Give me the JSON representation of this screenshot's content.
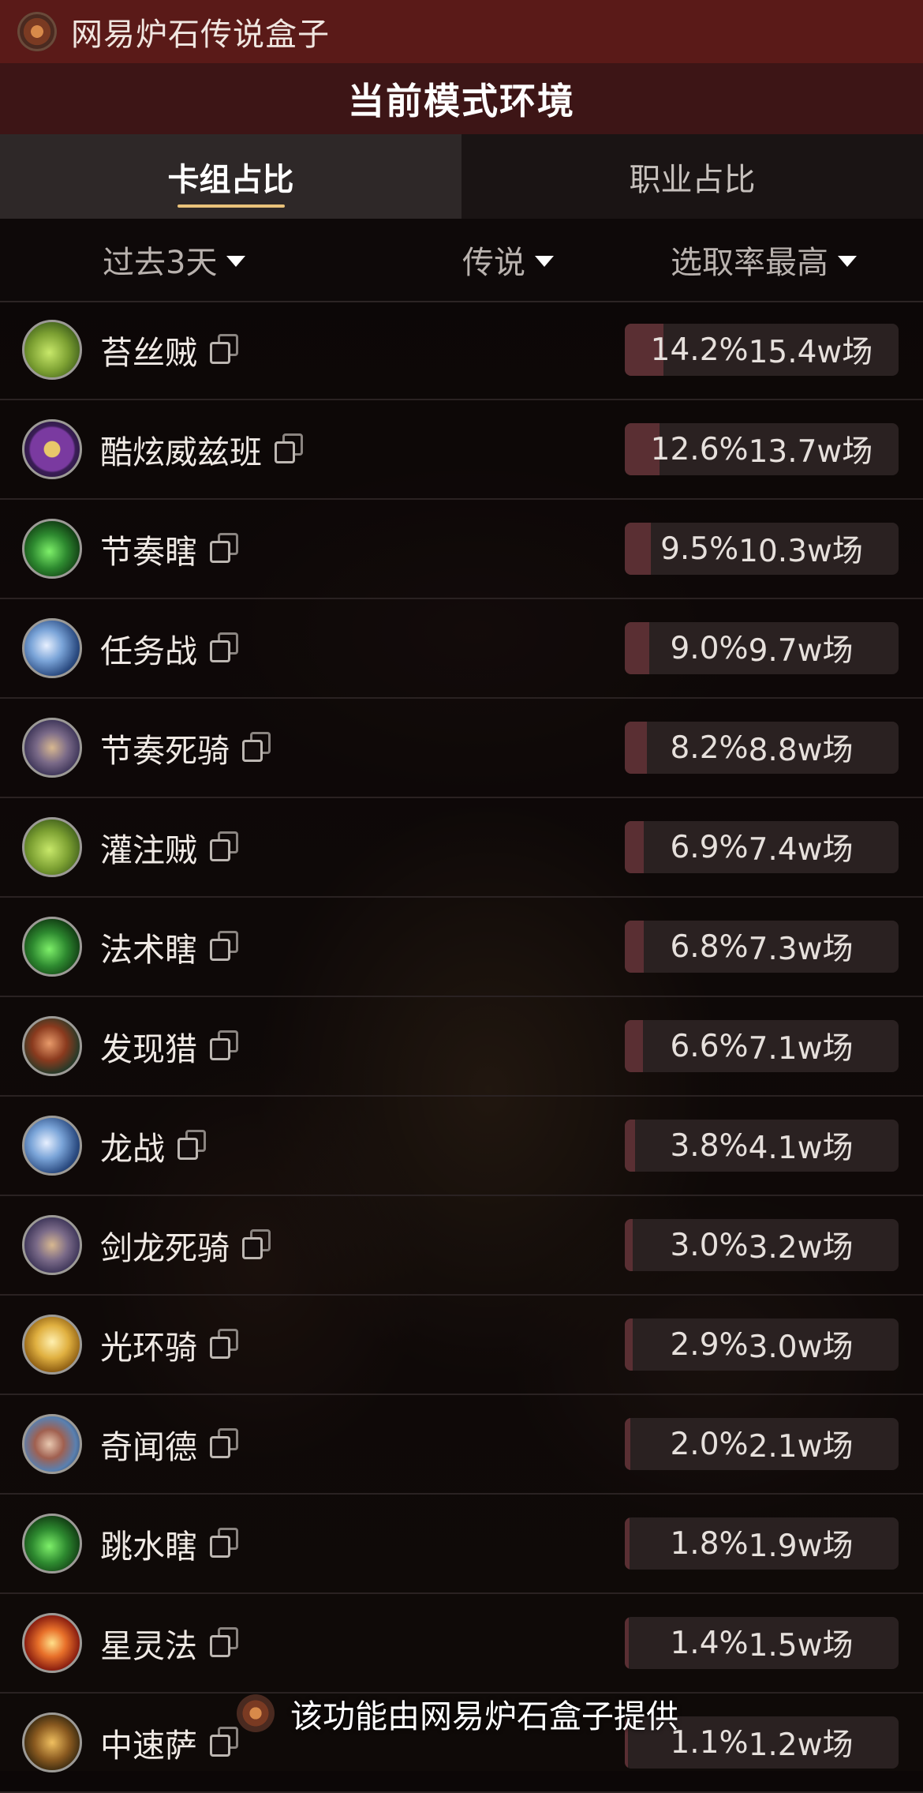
{
  "app": {
    "title": "网易炉石传说盒子"
  },
  "mode": {
    "title": "当前模式环境"
  },
  "tabs": [
    {
      "label": "卡组占比",
      "active": true
    },
    {
      "label": "职业占比",
      "active": false
    }
  ],
  "filters": {
    "time": "过去3天",
    "rank": "传说",
    "sort": "选取率最高"
  },
  "decks": [
    {
      "name": "苔丝贼",
      "rate": "14.2%",
      "games": "15.4w场",
      "rate_value": 14.2,
      "icon": "rogue-class-icon"
    },
    {
      "name": "酷炫威兹班",
      "rate": "12.6%",
      "games": "13.7w场",
      "rate_value": 12.6,
      "icon": "mystery-question-icon"
    },
    {
      "name": "节奏瞎",
      "rate": "9.5%",
      "games": "10.3w场",
      "rate_value": 9.5,
      "icon": "demon-hunter-class-icon"
    },
    {
      "name": "任务战",
      "rate": "9.0%",
      "games": "9.7w场",
      "rate_value": 9.0,
      "icon": "warrior-class-icon"
    },
    {
      "name": "节奏死骑",
      "rate": "8.2%",
      "games": "8.8w场",
      "rate_value": 8.2,
      "icon": "death-knight-class-icon"
    },
    {
      "name": "灌注贼",
      "rate": "6.9%",
      "games": "7.4w场",
      "rate_value": 6.9,
      "icon": "rogue-class-icon"
    },
    {
      "name": "法术瞎",
      "rate": "6.8%",
      "games": "7.3w场",
      "rate_value": 6.8,
      "icon": "demon-hunter-class-icon"
    },
    {
      "name": "发现猎",
      "rate": "6.6%",
      "games": "7.1w场",
      "rate_value": 6.6,
      "icon": "hunter-class-icon"
    },
    {
      "name": "龙战",
      "rate": "3.8%",
      "games": "4.1w场",
      "rate_value": 3.8,
      "icon": "warrior-class-icon"
    },
    {
      "name": "剑龙死骑",
      "rate": "3.0%",
      "games": "3.2w场",
      "rate_value": 3.0,
      "icon": "death-knight-class-icon"
    },
    {
      "name": "光环骑",
      "rate": "2.9%",
      "games": "3.0w场",
      "rate_value": 2.9,
      "icon": "paladin-class-icon"
    },
    {
      "name": "奇闻德",
      "rate": "2.0%",
      "games": "2.1w场",
      "rate_value": 2.0,
      "icon": "druid-class-icon"
    },
    {
      "name": "跳水瞎",
      "rate": "1.8%",
      "games": "1.9w场",
      "rate_value": 1.8,
      "icon": "demon-hunter-class-icon"
    },
    {
      "name": "星灵法",
      "rate": "1.4%",
      "games": "1.5w场",
      "rate_value": 1.4,
      "icon": "mage-class-icon"
    },
    {
      "name": "中速萨",
      "rate": "1.1%",
      "games": "1.2w场",
      "rate_value": 1.1,
      "icon": "shaman-class-icon"
    }
  ],
  "footer": {
    "note": "该功能由网易炉石盒子提供"
  },
  "colors": {
    "top_bar": "#5a1a18",
    "mode_bar": "#3d1516",
    "tab_underline": "#e9c27a",
    "rate_fill": "#5a2f33",
    "rate_track": "#2a2121"
  }
}
